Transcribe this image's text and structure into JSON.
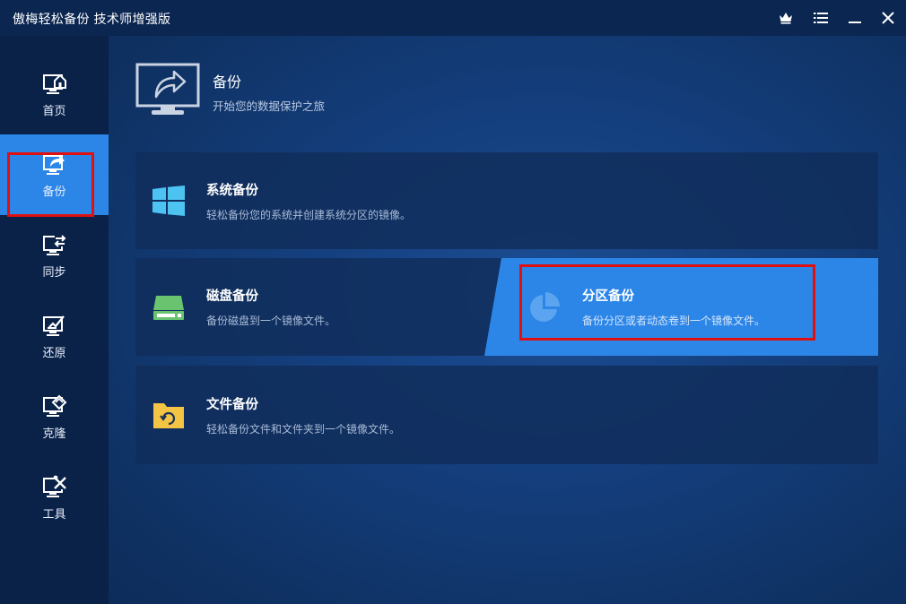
{
  "window": {
    "title": "傲梅轻松备份 技术师增强版",
    "controls": {
      "upgrade_icon": "crown-icon",
      "menu_icon": "menu-icon",
      "minimize_icon": "minimize-icon",
      "close_icon": "close-icon"
    }
  },
  "sidebar": {
    "items": [
      {
        "label": "首页",
        "icon": "home-monitor-icon",
        "active": false
      },
      {
        "label": "备份",
        "icon": "backup-monitor-icon",
        "active": true
      },
      {
        "label": "同步",
        "icon": "sync-monitor-icon",
        "active": false
      },
      {
        "label": "还原",
        "icon": "restore-monitor-icon",
        "active": false
      },
      {
        "label": "克隆",
        "icon": "clone-monitor-icon",
        "active": false
      },
      {
        "label": "工具",
        "icon": "tools-monitor-icon",
        "active": false
      }
    ]
  },
  "header": {
    "title": "备份",
    "subtitle": "开始您的数据保护之旅",
    "icon": "backup-screen-icon"
  },
  "cards": {
    "system": {
      "title": "系统备份",
      "desc": "轻松备份您的系统并创建系统分区的镜像。",
      "icon": "windows-icon"
    },
    "disk": {
      "title": "磁盘备份",
      "desc": "备份磁盘到一个镜像文件。",
      "icon": "disk-icon"
    },
    "partition": {
      "title": "分区备份",
      "desc": "备份分区或者动态卷到一个镜像文件。",
      "icon": "partition-pie-icon",
      "highlighted": true
    },
    "file": {
      "title": "文件备份",
      "desc": "轻松备份文件和文件夹到一个镜像文件。",
      "icon": "folder-sync-icon"
    }
  },
  "colors": {
    "accent": "#2c86e8",
    "highlight_border": "#e01010",
    "sidebar_bg": "#0a2248",
    "titlebar_bg": "#0b2650"
  }
}
